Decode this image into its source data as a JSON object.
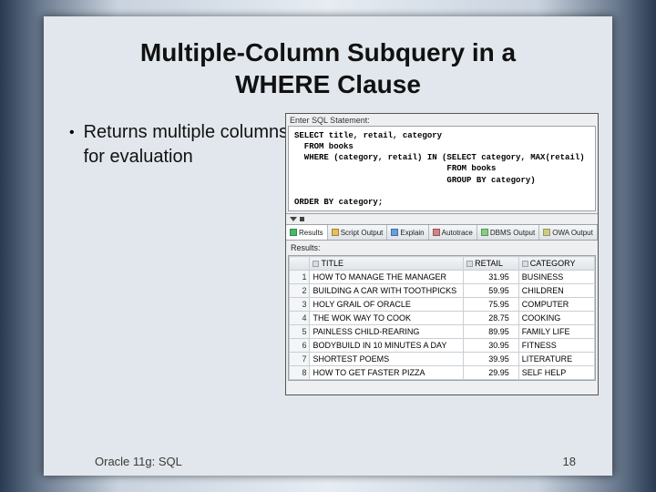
{
  "title_line1": "Multiple-Column Subquery in a",
  "title_line2": "WHERE Clause",
  "bullet": "Returns multiple columns for evaluation",
  "ide": {
    "enter_label": "Enter SQL Statement:",
    "sql": "SELECT title, retail, category\n  FROM books\n  WHERE (category, retail) IN (SELECT category, MAX(retail)\n                               FROM books\n                               GROUP BY category)\n\nORDER BY category;",
    "tabs": [
      "Results",
      "Script Output",
      "Explain",
      "Autotrace",
      "DBMS Output",
      "OWA Output"
    ],
    "results_label": "Results:",
    "columns": [
      "TITLE",
      "RETAIL",
      "CATEGORY"
    ],
    "rows": [
      {
        "n": 1,
        "title": "HOW TO MANAGE THE MANAGER",
        "retail": "31.95",
        "cat": "BUSINESS"
      },
      {
        "n": 2,
        "title": "BUILDING A CAR WITH TOOTHPICKS",
        "retail": "59.95",
        "cat": "CHILDREN"
      },
      {
        "n": 3,
        "title": "HOLY GRAIL OF ORACLE",
        "retail": "75.95",
        "cat": "COMPUTER"
      },
      {
        "n": 4,
        "title": "THE WOK WAY TO COOK",
        "retail": "28.75",
        "cat": "COOKING"
      },
      {
        "n": 5,
        "title": "PAINLESS CHILD-REARING",
        "retail": "89.95",
        "cat": "FAMILY LIFE"
      },
      {
        "n": 6,
        "title": "BODYBUILD IN 10 MINUTES A DAY",
        "retail": "30.95",
        "cat": "FITNESS"
      },
      {
        "n": 7,
        "title": "SHORTEST POEMS",
        "retail": "39.95",
        "cat": "LITERATURE"
      },
      {
        "n": 8,
        "title": "HOW TO GET FASTER PIZZA",
        "retail": "29.95",
        "cat": "SELF HELP"
      }
    ]
  },
  "footer_left": "Oracle 11g: SQL",
  "footer_right": "18"
}
